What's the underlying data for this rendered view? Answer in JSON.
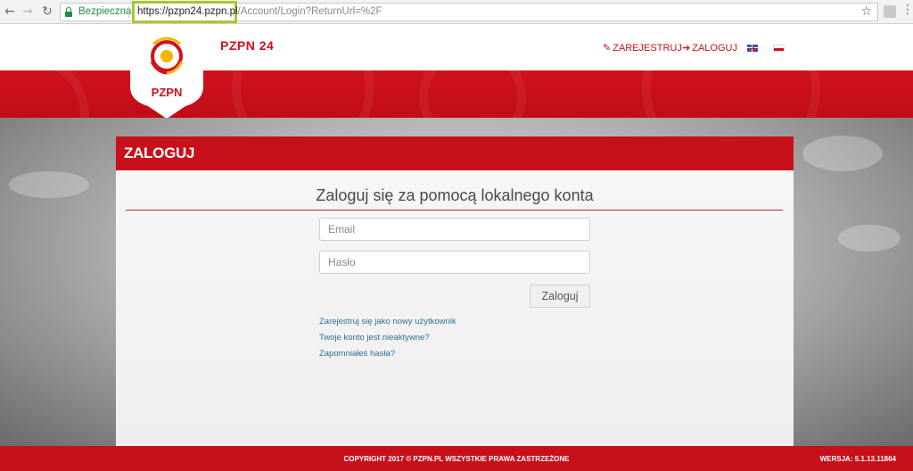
{
  "browser": {
    "secure_label": "Bezpieczna",
    "url_host": "https://pzpn24.pzpn.pl",
    "url_path": "/Account/Login?ReturnUrl=%2F"
  },
  "site": {
    "logo_text": "PZPN",
    "brand": "PZPN 24",
    "nav": {
      "register": "ZAREJESTRUJ",
      "login": "ZALOGUJ"
    },
    "colors": {
      "brand_red": "#d0101c",
      "link_blue": "#2d6e96"
    }
  },
  "login": {
    "panel_title": "ZALOGUJ",
    "subtitle": "Zaloguj się za pomocą lokalnego konta",
    "email_placeholder": "Email",
    "password_placeholder": "Hasło",
    "submit_label": "Zaloguj",
    "links": {
      "register": "Zarejestruj się jako nowy użytkownik",
      "inactive": "Twoje konto jest nieaktywne?",
      "forgot": "Zapomniałeś hasła?"
    }
  },
  "footer": {
    "copyright": "COPYRIGHT 2017 © PZPN.PL WSZYSTKIE PRAWA ZASTRZEŻONE",
    "version": "WERSJA: 5.1.13.11864"
  }
}
